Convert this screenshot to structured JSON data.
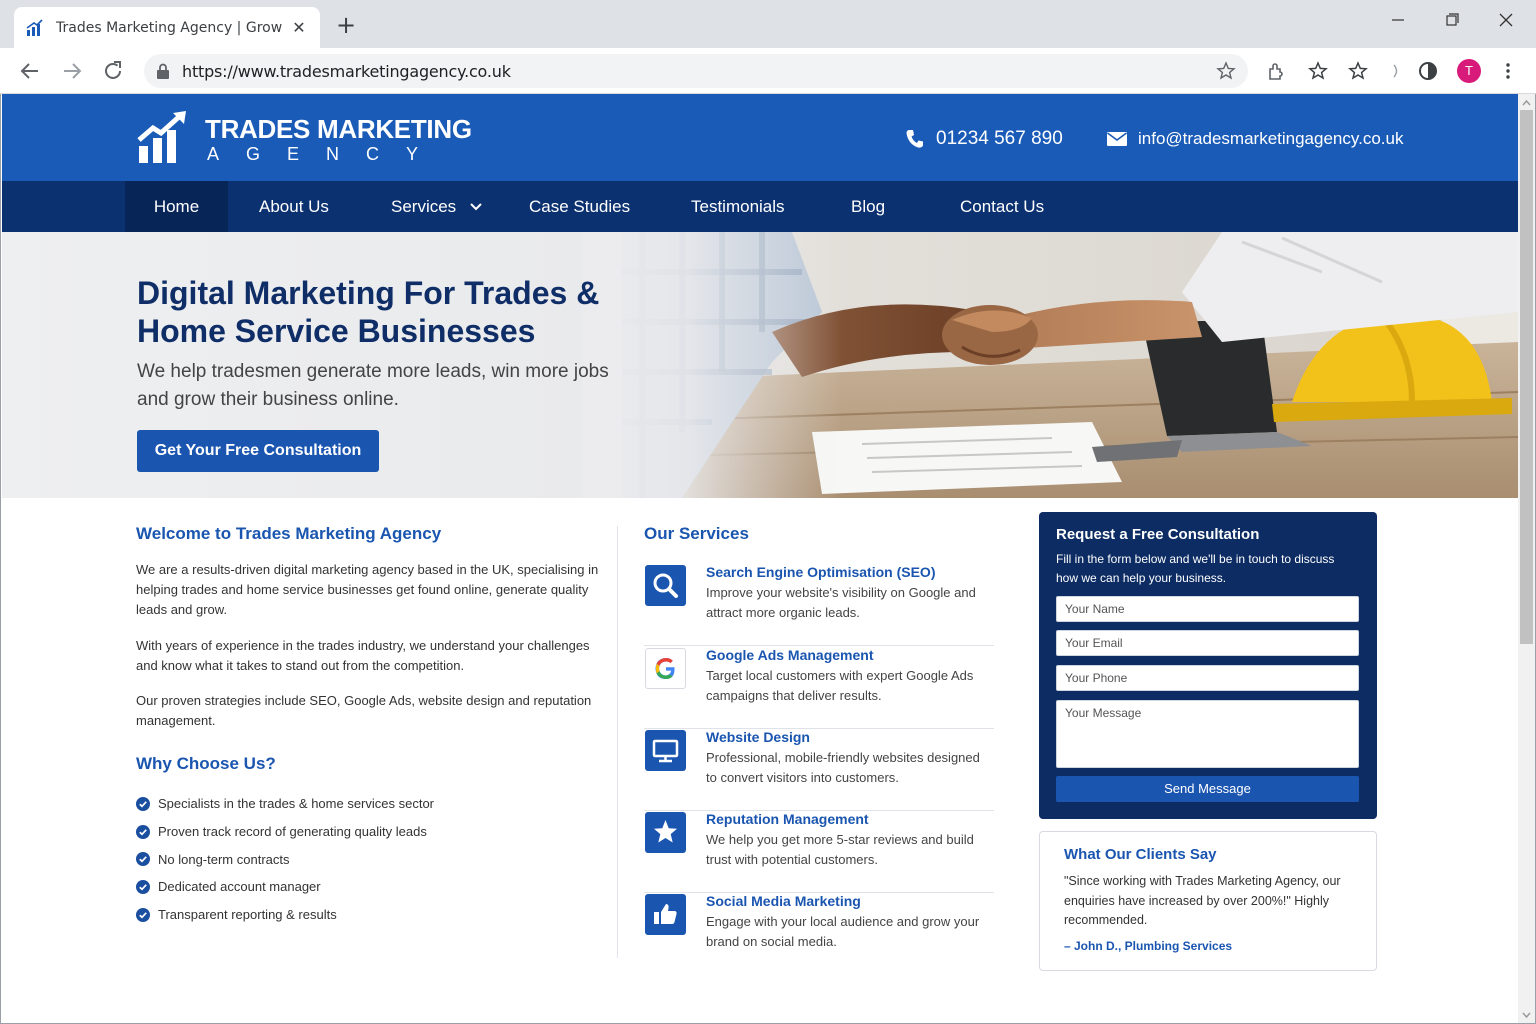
{
  "browser": {
    "tab_title": "Trades Marketing Agency | Grow Your",
    "url": "https://www.tradesmarketingagency.co.uk",
    "avatar_letter": "T"
  },
  "header": {
    "logo_line1": "TRADES MARKETING",
    "logo_line2": "AGENCY",
    "phone": "01234 567 890",
    "email": "info@tradesmarketingagency.co.uk"
  },
  "nav": {
    "items": [
      {
        "label": "Home"
      },
      {
        "label": "About Us"
      },
      {
        "label": "Services"
      },
      {
        "label": "Case Studies"
      },
      {
        "label": "Testimonials"
      },
      {
        "label": "Blog"
      },
      {
        "label": "Contact Us"
      }
    ],
    "active": "Home"
  },
  "hero": {
    "title": "Digital Marketing For Trades & Home Service Businesses",
    "subtitle": "We help tradesmen generate more leads, win more jobs and grow their business online.",
    "cta": "Get Your Free Consultation"
  },
  "welcome": {
    "title": "Welcome to Trades Marketing Agency",
    "paragraphs": [
      "We are a results-driven digital marketing agency based in the UK, specialising in helping trades and home service businesses get found online, generate quality leads and grow.",
      "With years of experience in the trades industry, we understand your challenges and know what it takes to stand out from the competition.",
      "Our proven strategies include SEO, Google Ads, website design and reputation management."
    ]
  },
  "why": {
    "title": "Why Choose Us?",
    "items": [
      "Specialists in the trades & home services sector",
      "Proven track record of generating quality leads",
      "No long-term contracts",
      "Dedicated account manager",
      "Transparent reporting & results"
    ]
  },
  "services": {
    "title": "Our Services",
    "items": [
      {
        "title": "Search Engine Optimisation (SEO)",
        "desc": "Improve your website's visibility on Google and attract more organic leads.",
        "icon": "search-icon"
      },
      {
        "title": "Google Ads Management",
        "desc": "Target local customers with expert Google Ads campaigns that deliver results.",
        "icon": "google-icon"
      },
      {
        "title": "Website Design",
        "desc": "Professional, mobile-friendly websites designed to convert visitors into customers.",
        "icon": "monitor-icon"
      },
      {
        "title": "Reputation Management",
        "desc": "We help you get more 5-star reviews and build trust with potential customers.",
        "icon": "star-icon"
      },
      {
        "title": "Social Media Marketing",
        "desc": "Engage with your local audience and grow your brand on social media.",
        "icon": "thumbs-up-icon"
      }
    ]
  },
  "form": {
    "title": "Request a Free Consultation",
    "intro": "Fill in the form below and we'll be in touch to discuss how we can help your business.",
    "name_placeholder": "Your Name",
    "email_placeholder": "Your Email",
    "phone_placeholder": "Your Phone",
    "message_placeholder": "Your Message",
    "submit": "Send Message"
  },
  "testimonial": {
    "title": "What Our Clients Say",
    "quote": "\"Since working with Trades Marketing Agency, our enquiries have increased by over 200%!\" Highly recommended.",
    "author": "– John D., Plumbing Services"
  },
  "colors": {
    "brand_blue": "#1a5bb8",
    "nav_navy": "#0c3170",
    "heading_navy": "#0f2d66",
    "link_blue": "#1a55b0"
  }
}
